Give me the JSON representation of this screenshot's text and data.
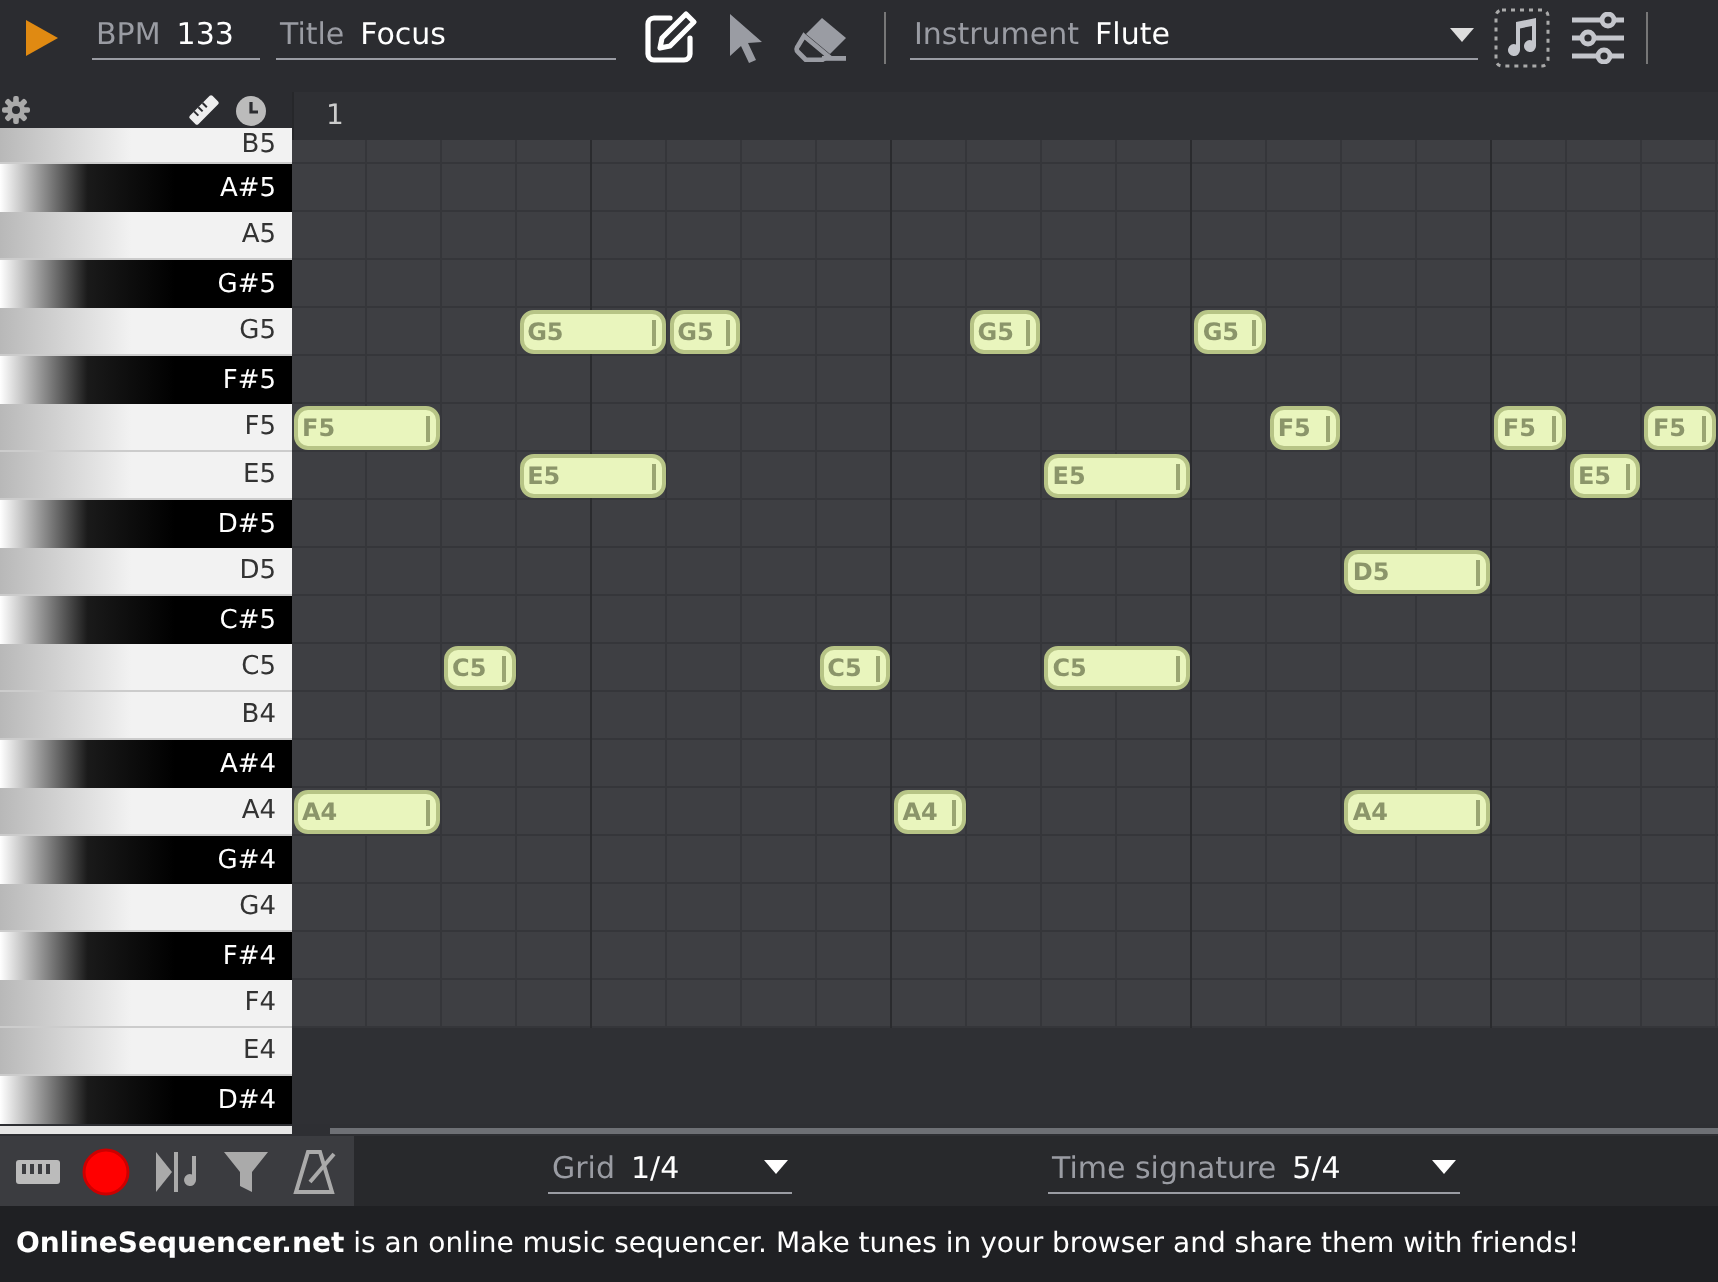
{
  "toolbar": {
    "bpm": {
      "label": "BPM",
      "value": "133"
    },
    "title": {
      "label": "Title",
      "value": "Focus"
    },
    "tools": [
      {
        "kind": "pencil",
        "selected": true
      },
      {
        "kind": "pointer",
        "selected": false
      },
      {
        "kind": "eraser",
        "selected": false
      }
    ],
    "instrument": {
      "label": "Instrument",
      "value": "Flute"
    },
    "options": [
      {
        "kind": "note",
        "selected": true
      },
      {
        "kind": "sliders",
        "selected": false
      }
    ]
  },
  "ruler": {
    "markers": [
      "1"
    ]
  },
  "piano_roll": {
    "rows": [
      {
        "label": "B5",
        "kind": "white",
        "notes": []
      },
      {
        "label": "A#5",
        "kind": "black",
        "notes": []
      },
      {
        "label": "A5",
        "kind": "white",
        "notes": []
      },
      {
        "label": "G#5",
        "kind": "black",
        "notes": []
      },
      {
        "label": "G5",
        "kind": "white",
        "notes": [
          {
            "label": "G5"
          },
          {
            "label": "G5"
          },
          {
            "label": "G5"
          },
          {
            "label": "G5"
          }
        ]
      },
      {
        "label": "F#5",
        "kind": "black",
        "notes": []
      },
      {
        "label": "F5",
        "kind": "white",
        "notes": [
          {
            "label": "F5"
          },
          {
            "label": "F5"
          },
          {
            "label": "F5"
          },
          {
            "label": "F5"
          }
        ]
      },
      {
        "label": "E5",
        "kind": "white",
        "notes": [
          {
            "label": "E5"
          },
          {
            "label": "E5"
          },
          {
            "label": "E5"
          }
        ]
      },
      {
        "label": "D#5",
        "kind": "black",
        "notes": []
      },
      {
        "label": "D5",
        "kind": "white",
        "notes": [
          {
            "label": "D5"
          }
        ]
      },
      {
        "label": "C#5",
        "kind": "black",
        "notes": []
      },
      {
        "label": "C5",
        "kind": "white",
        "notes": [
          {
            "label": "C5"
          },
          {
            "label": "C5"
          },
          {
            "label": "C5"
          }
        ]
      },
      {
        "label": "B4",
        "kind": "white",
        "notes": []
      },
      {
        "label": "A#4",
        "kind": "black",
        "notes": []
      },
      {
        "label": "A4",
        "kind": "white",
        "notes": [
          {
            "label": "A4"
          },
          {
            "label": "A4"
          },
          {
            "label": "A4"
          }
        ]
      },
      {
        "label": "G#4",
        "kind": "black",
        "notes": []
      },
      {
        "label": "G4",
        "kind": "white",
        "notes": []
      },
      {
        "label": "F#4",
        "kind": "black",
        "notes": []
      },
      {
        "label": "F4",
        "kind": "white",
        "notes": []
      },
      {
        "label": "E4",
        "kind": "white",
        "notes": []
      },
      {
        "label": "D#4",
        "kind": "black",
        "notes": []
      }
    ]
  },
  "bottom_bar": {
    "tools": [
      {
        "kind": "keyboard"
      },
      {
        "kind": "record"
      },
      {
        "kind": "flip"
      },
      {
        "kind": "filter"
      },
      {
        "kind": "metronome"
      }
    ],
    "grid": {
      "label": "Grid",
      "value": "1/4"
    },
    "time_signature": {
      "label": "Time signature",
      "value": "5/4"
    }
  },
  "footer": {
    "text": "**OnlineSequencer.net** is an online music sequencer. Make tunes in your browser and share them with friends!"
  }
}
